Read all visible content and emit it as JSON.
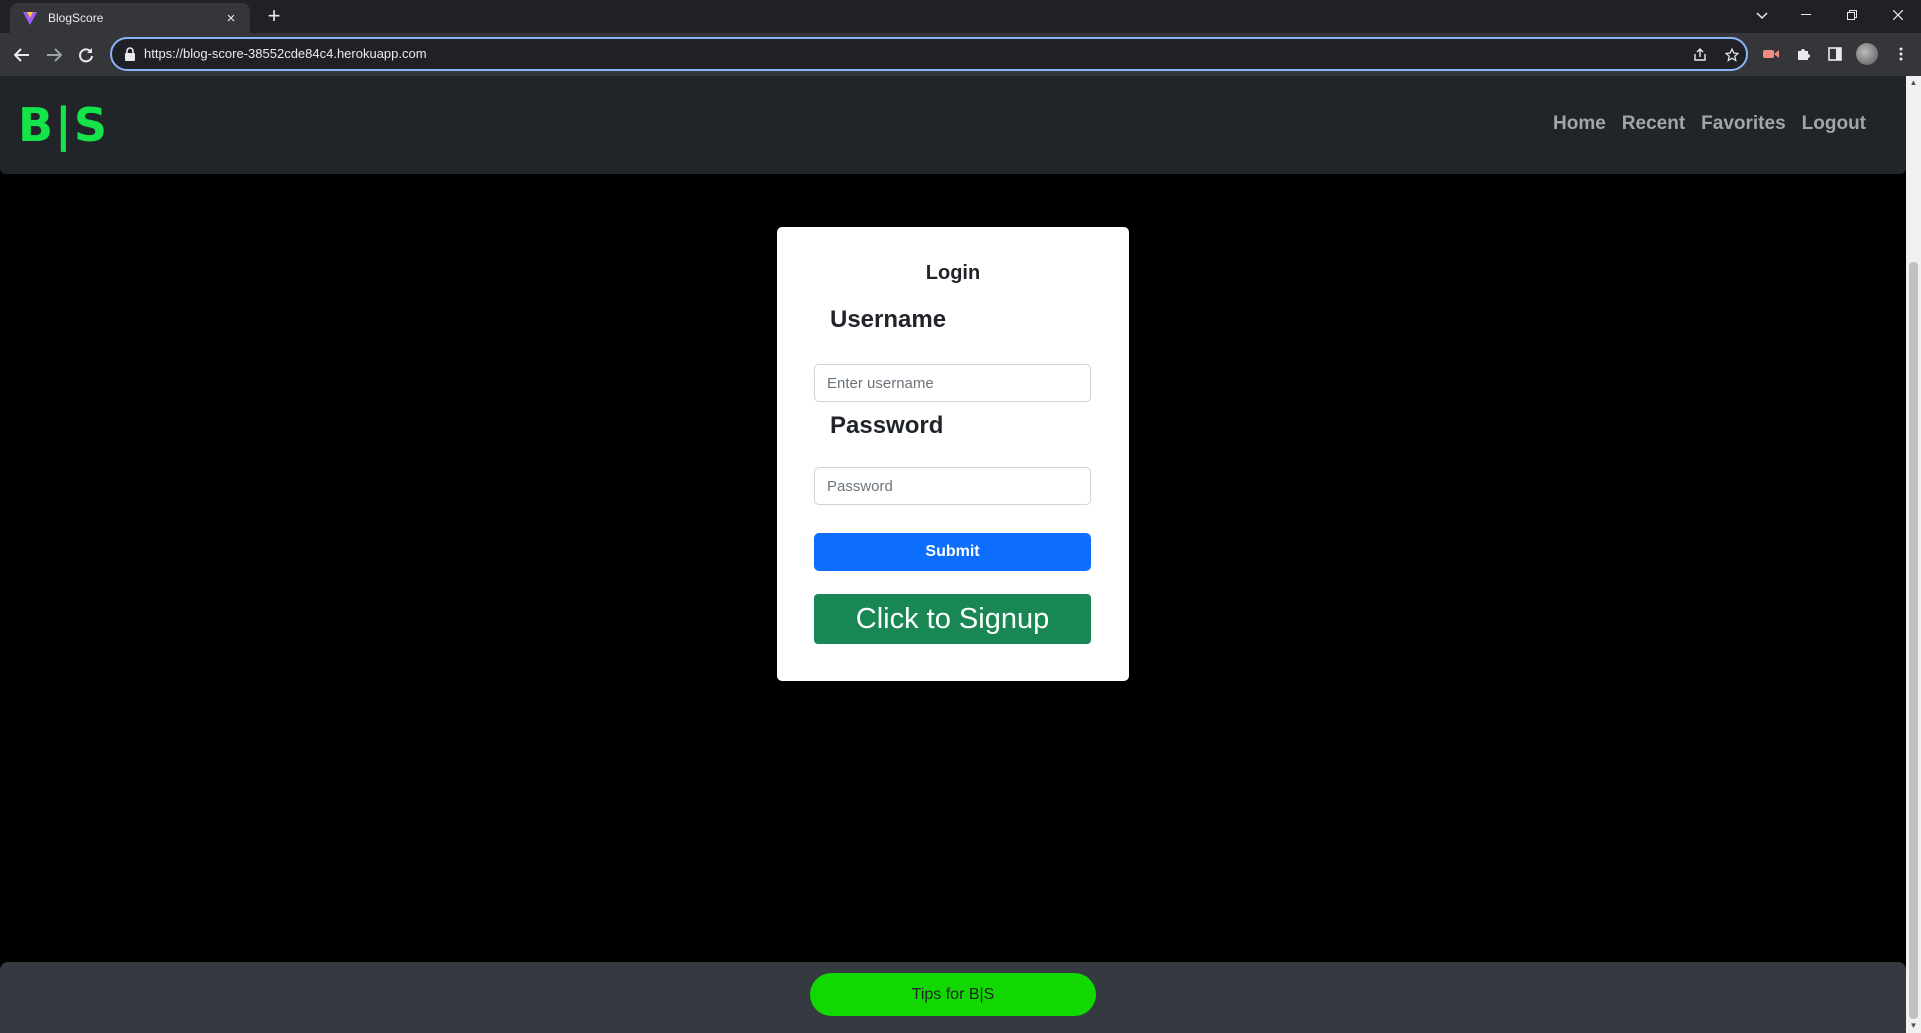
{
  "browser": {
    "tab_title": "BlogScore",
    "url": "https://blog-score-38552cde84c4.herokuapp.com",
    "new_tab_symbol": "+",
    "close_symbol": "×"
  },
  "navbar": {
    "logo": "B|S",
    "links": [
      {
        "label": "Home"
      },
      {
        "label": "Recent"
      },
      {
        "label": "Favorites"
      },
      {
        "label": "Logout"
      }
    ]
  },
  "login": {
    "title": "Login",
    "username_label": "Username",
    "username_placeholder": "Enter username",
    "password_label": "Password",
    "password_placeholder": "Password",
    "submit_label": "Submit",
    "signup_label": "Click to Signup"
  },
  "footer": {
    "tips_label": "Tips for B|S"
  },
  "colors": {
    "logo_green": "#14e34a",
    "submit_blue": "#0d6efd",
    "signup_green": "#198754",
    "tips_green": "#10d800",
    "navbar_bg": "#212529",
    "footer_bg": "#343a40"
  }
}
